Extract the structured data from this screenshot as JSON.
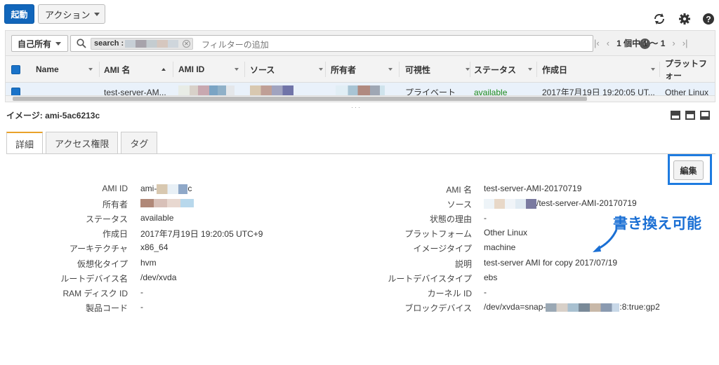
{
  "toolbar": {
    "launch_label": "起動",
    "action_label": "アクション"
  },
  "filter": {
    "owner_label": "自己所有",
    "token_key": "search :",
    "placeholder": "フィルターの追加",
    "pager_text": "1 個中 1 ～ 1"
  },
  "table": {
    "headers": [
      "Name",
      "AMI 名",
      "AMI ID",
      "ソース",
      "所有者",
      "可視性",
      "ステータス",
      "作成日",
      "プラットフォー"
    ],
    "row": {
      "ami_name": "test-server-AM...",
      "visibility": "プライベート",
      "status": "available",
      "created": "2017年7月19日 19:20:05 UT...",
      "platform": "Other Linux"
    }
  },
  "detail": {
    "title": "イメージ: ami-5ac6213c",
    "tabs": [
      "詳細",
      "アクセス権限",
      "タグ"
    ],
    "edit_label": "編集",
    "left": [
      {
        "label": "AMI ID",
        "value": "ami-"
      },
      {
        "label": "所有者",
        "value": ""
      },
      {
        "label": "ステータス",
        "value": "available"
      },
      {
        "label": "作成日",
        "value": "2017年7月19日 19:20:05 UTC+9"
      },
      {
        "label": "アーキテクチャ",
        "value": "x86_64"
      },
      {
        "label": "仮想化タイプ",
        "value": "hvm"
      },
      {
        "label": "ルートデバイス名",
        "value": "/dev/xvda"
      },
      {
        "label": "RAM ディスク ID",
        "value": "-"
      },
      {
        "label": "製品コード",
        "value": "-"
      }
    ],
    "right": [
      {
        "label": "AMI 名",
        "value": "test-server-AMI-20170719"
      },
      {
        "label": "ソース",
        "value": "/test-server-AMI-20170719"
      },
      {
        "label": "状態の理由",
        "value": "-"
      },
      {
        "label": "プラットフォーム",
        "value": "Other Linux"
      },
      {
        "label": "イメージタイプ",
        "value": "machine"
      },
      {
        "label": "説明",
        "value": "test-server AMI for copy 2017/07/19"
      },
      {
        "label": "ルートデバイスタイプ",
        "value": "ebs"
      },
      {
        "label": "カーネル ID",
        "value": "-"
      },
      {
        "label": "ブロックデバイス",
        "value": "/dev/xvda=snap-"
      }
    ],
    "ami_id_suffix": "c",
    "block_device_suffix": ":8:true:gp2"
  },
  "annotation": {
    "callout_text": "書き換え可能",
    "color": "#1a6fd4"
  },
  "icons": {
    "refresh": "refresh-icon",
    "settings": "gear-icon",
    "help": "help-icon"
  }
}
